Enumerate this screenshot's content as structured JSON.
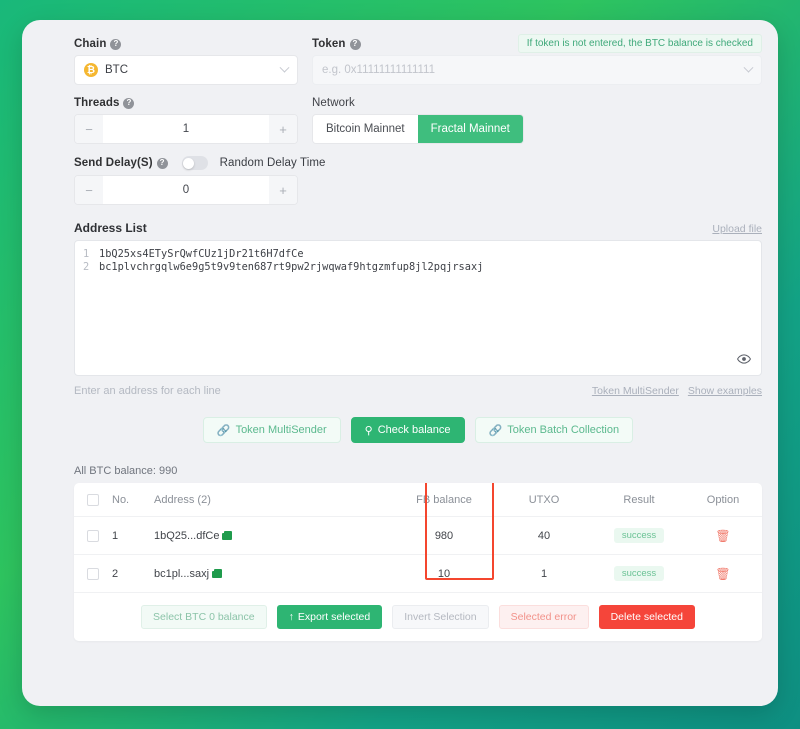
{
  "form": {
    "chain": {
      "label": "Chain",
      "help": "?",
      "value": "BTC",
      "token_symbol": "₿"
    },
    "token": {
      "label": "Token",
      "help": "?",
      "placeholder": "e.g. 0x11111111111111",
      "value": "",
      "hint": "If token is not entered, the BTC balance is checked"
    },
    "threads": {
      "label": "Threads",
      "help": "?",
      "value": "1",
      "minus": "−",
      "plus": "+"
    },
    "network": {
      "label": "Network",
      "options": [
        "Bitcoin Mainnet",
        "Fractal Mainnet"
      ],
      "selected": "Fractal Mainnet"
    },
    "send_delay": {
      "label": "Send Delay(S)",
      "help": "?",
      "toggle_label": "Random Delay Time",
      "toggle_on": false,
      "value": "0",
      "minus": "−",
      "plus": "+"
    }
  },
  "address_list": {
    "title": "Address List",
    "upload_link": "Upload file",
    "lines": [
      {
        "no": "1",
        "text": "1bQ25xs4ETySrQwfCUz1jDr21t6H7dfCe"
      },
      {
        "no": "2",
        "text": "bc1plvchrgqlw6e9g5t9v9ten687rt9pw2rjwqwaf9htgzmfup8jl2pqjrsaxj"
      }
    ],
    "hint": "Enter an address for each line",
    "links": [
      "Token MultiSender",
      "Show examples"
    ]
  },
  "actions": [
    {
      "label": "Token MultiSender",
      "icon": "link-icon",
      "style": "ghost"
    },
    {
      "label": "Check balance",
      "icon": "search-icon",
      "style": "primary"
    },
    {
      "label": "Token Batch Collection",
      "icon": "link-icon",
      "style": "ghost"
    }
  ],
  "results": {
    "summary": "All BTC balance: 990",
    "columns": [
      "No.",
      "Address (2)",
      "FB balance",
      "UTXO",
      "Result",
      "Option"
    ],
    "rows": [
      {
        "no": "1",
        "address": "1bQ25...dfCe",
        "balance": "980",
        "utxo": "40",
        "result": "success"
      },
      {
        "no": "2",
        "address": "bc1pl...saxj",
        "balance": "10",
        "utxo": "1",
        "result": "success"
      }
    ],
    "highlight_color": "#f4462e",
    "footer_buttons": [
      {
        "label": "Select BTC 0 balance",
        "style": "pale-green"
      },
      {
        "label": "Export selected",
        "style": "solid-green",
        "icon": "upload-icon"
      },
      {
        "label": "Invert Selection",
        "style": "pale-gray"
      },
      {
        "label": "Selected error",
        "style": "pale-red"
      },
      {
        "label": "Delete selected",
        "style": "solid-red"
      }
    ]
  }
}
